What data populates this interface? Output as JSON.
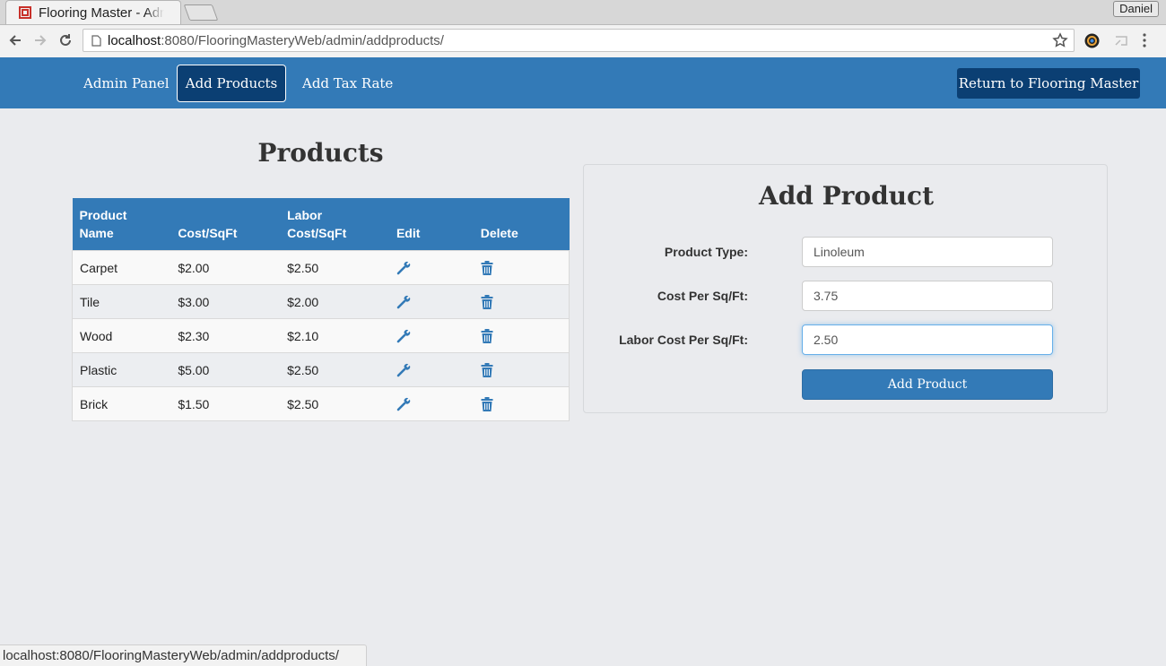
{
  "browser": {
    "tab_title": "Flooring Master - Admin",
    "profile_name": "Daniel",
    "url_host": "localhost",
    "url_path": ":8080/FlooringMasteryWeb/admin/addproducts/",
    "status_url": "localhost:8080/FlooringMasteryWeb/admin/addproducts/"
  },
  "nav": {
    "items": [
      {
        "label": "Admin Panel",
        "active": false
      },
      {
        "label": "Add Products",
        "active": true
      },
      {
        "label": "Add Tax Rate",
        "active": false
      }
    ],
    "return_label": "Return to Flooring Master"
  },
  "products": {
    "title": "Products",
    "headers": {
      "name_line1": "Product",
      "name_line2": "Name",
      "cost": "Cost/SqFt",
      "labor_line1": "Labor",
      "labor_line2": "Cost/SqFt",
      "edit": "Edit",
      "delete": "Delete"
    },
    "rows": [
      {
        "name": "Carpet",
        "cost": "$2.00",
        "labor": "$2.50"
      },
      {
        "name": "Tile",
        "cost": "$3.00",
        "labor": "$2.00"
      },
      {
        "name": "Wood",
        "cost": "$2.30",
        "labor": "$2.10"
      },
      {
        "name": "Plastic",
        "cost": "$5.00",
        "labor": "$2.50"
      },
      {
        "name": "Brick",
        "cost": "$1.50",
        "labor": "$2.50"
      }
    ]
  },
  "form": {
    "title": "Add Product",
    "product_type_label": "Product Type:",
    "product_type_value": "Linoleum",
    "cost_label": "Cost Per Sq/Ft:",
    "cost_value": "3.75",
    "labor_label": "Labor Cost Per Sq/Ft:",
    "labor_value": "2.50",
    "submit_label": "Add Product"
  },
  "icons": {
    "edit": "wrench-icon",
    "delete": "trash-icon"
  },
  "colors": {
    "brand": "#337ab7",
    "nav_active": "#0b3f73",
    "page_bg": "#eaebee"
  }
}
